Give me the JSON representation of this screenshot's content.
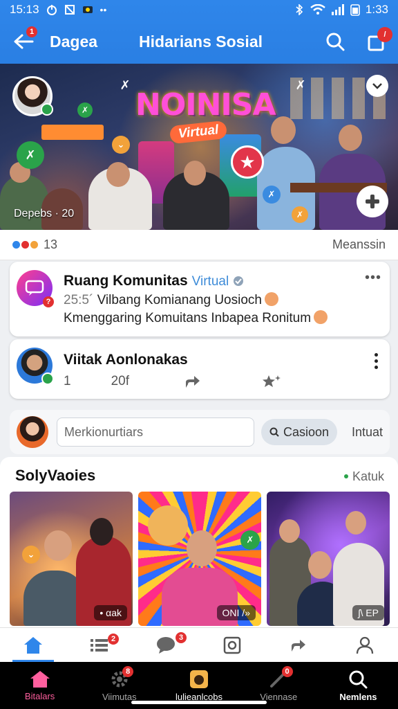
{
  "status": {
    "time": "15:13",
    "clock_right": "1:33"
  },
  "header": {
    "left_title": "Dagea",
    "title": "Hidarians Sosial",
    "back_badge": "1",
    "notif_badge": "/"
  },
  "hero": {
    "logo_main": "NOINISA",
    "logo_sub": "Virtual",
    "caption": "Depebs · 20"
  },
  "reactions": {
    "count": "13",
    "right_label": "Meanssin"
  },
  "post1": {
    "author": "Ruang Komunitas",
    "tag": "Virtual",
    "line1_prefix": "25:5´",
    "line1": "Vilbang Komianang Uosioch",
    "line2": "Kmenggaring Komuitans Inbapea Ronitum"
  },
  "post2": {
    "author": "Viitak Aonlonakas",
    "stat1": "1",
    "stat2": "20f"
  },
  "comment": {
    "placeholder": "Merkionurtiars",
    "button": "Casioon",
    "link": "Intuat"
  },
  "stories": {
    "title": "SolyVaoies",
    "right_label": "Katuk",
    "items": [
      {
        "label": "• αak"
      },
      {
        "label": "ONI /»"
      },
      {
        "label": "ʃ\\ EP"
      }
    ]
  },
  "tabs": {
    "list_badge": "2",
    "chat_badge": "3"
  },
  "sysnav": {
    "items": [
      {
        "label": "Bitalars"
      },
      {
        "label": "Viimutas",
        "badge": "8"
      },
      {
        "label": "lulieanlcobs"
      },
      {
        "label": "Viennase",
        "badge": "0"
      },
      {
        "label": "Nemlens"
      }
    ]
  },
  "colors": {
    "primary": "#2f86ea",
    "accent_red": "#e23030",
    "nav_active": "#ff5f9e"
  }
}
